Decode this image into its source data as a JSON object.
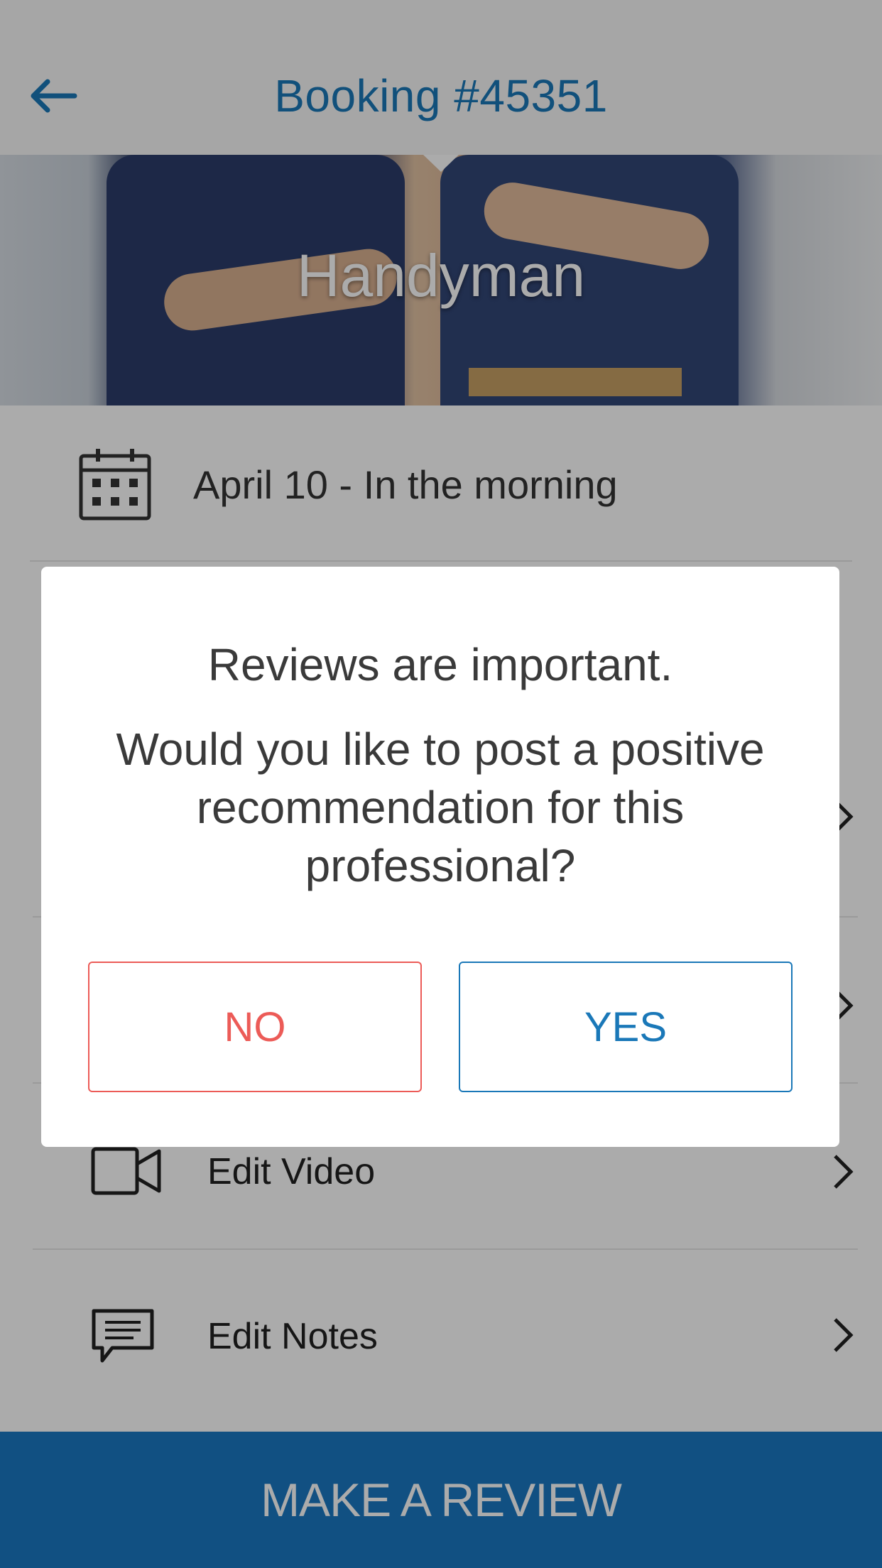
{
  "header": {
    "title": "Booking #45351",
    "back_icon": "arrow-left-icon"
  },
  "hero": {
    "title": "Handyman"
  },
  "booking": {
    "date_text": "April 10 - In the morning",
    "date_icon": "calendar-icon"
  },
  "rows": [
    {
      "label": "Edit Video",
      "icon": "video-camera-icon"
    },
    {
      "label": "Edit Notes",
      "icon": "chat-bubble-icon"
    }
  ],
  "footer": {
    "button_label": "MAKE A REVIEW"
  },
  "dialog": {
    "title": "Reviews are important.",
    "message": "Would you like to post a positive recommendation for this professional?",
    "no_label": "NO",
    "yes_label": "YES"
  },
  "colors": {
    "brand_blue": "#1a78b8",
    "footer_blue": "#1a78c2",
    "no_red": "#ec5b57",
    "overlay": "rgba(0,0,0,0.33)"
  }
}
